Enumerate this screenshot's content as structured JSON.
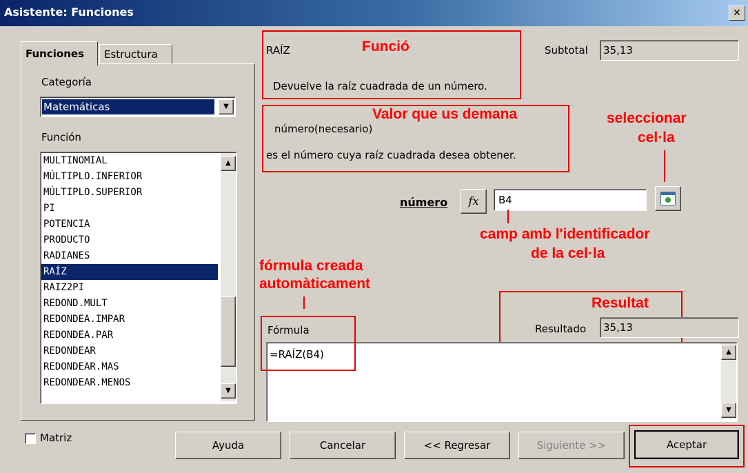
{
  "window": {
    "title": "Asistente: Funciones",
    "close_glyph": "✕"
  },
  "tabs": [
    {
      "label": "Funciones"
    },
    {
      "label": "Estructura"
    }
  ],
  "category": {
    "label": "Categoría",
    "value": "Matemáticas"
  },
  "function_list": {
    "label": "Función",
    "items": [
      "MULTINOMIAL",
      "MÚLTIPLO.INFERIOR",
      "MÚLTIPLO.SUPERIOR",
      "PI",
      "POTENCIA",
      "PRODUCTO",
      "RADIANES",
      "RAÍZ",
      "RAIZ2PI",
      "REDOND.MULT",
      "REDONDEA.IMPAR",
      "REDONDEA.PAR",
      "REDONDEAR",
      "REDONDEAR.MAS",
      "REDONDEAR.MENOS"
    ],
    "selected": "RAÍZ"
  },
  "function_info": {
    "name": "RAÍZ",
    "description": "Devuelve la raíz cuadrada de un número.",
    "subtotal_label": "Subtotal",
    "subtotal_value": "35,13",
    "param_title": "número(necesario)",
    "param_desc": "es el número cuya raíz cuadrada desea obtener."
  },
  "argument": {
    "label": "número",
    "fx_glyph": "fx",
    "value": "B4"
  },
  "result": {
    "label": "Resultado",
    "value": "35,13"
  },
  "formula": {
    "label": "Fórmula",
    "value": "=RAÍZ(B4)"
  },
  "matrix": {
    "label": "Matriz",
    "checked": false
  },
  "buttons": {
    "help": "Ayuda",
    "cancel": "Cancelar",
    "back": "<< Regresar",
    "next": "Siguiente >>",
    "ok": "Aceptar"
  },
  "annotations": {
    "funcio": "Funció",
    "valor": "Valor que us demana",
    "seleccionar_1": "seleccionar",
    "seleccionar_2": "cel·la",
    "camp_1": "camp amb l'identificador",
    "camp_2": "de la cel·la",
    "formula_1": "fórmula creada",
    "formula_2": "automàticament",
    "resultat": "Resultat"
  },
  "colors": {
    "annotation": "#ff0000",
    "selection": "#0a246a",
    "dialog": "#d4d0c8"
  }
}
